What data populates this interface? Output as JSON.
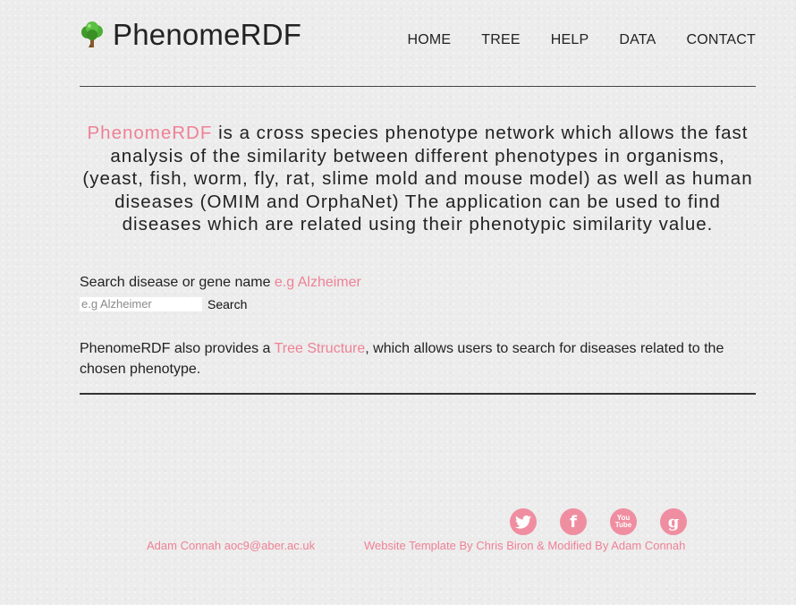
{
  "brand": {
    "name": "PhenomeRDF",
    "icon": "tree-icon"
  },
  "nav": [
    "HOME",
    "TREE",
    "HELP",
    "DATA",
    "CONTACT"
  ],
  "intro": {
    "highlight": "PhenomeRDF",
    "text": " is a cross species phenotype network which allows the fast analysis of the similarity between different phenotypes in organisms, (yeast, fish, worm, fly, rat, slime mold and mouse model) as well as human diseases (OMIM and OrphaNet) The application can be used to find diseases which are related using their phenotypic similarity value."
  },
  "search": {
    "label": "Search disease or gene name ",
    "example": "e.g Alzheimer",
    "placeholder": "e.g Alzheimer",
    "value": "",
    "button": "Search"
  },
  "tree_info": {
    "before": "PhenomeRDF also provides a ",
    "link": "Tree Structure",
    "after": ", which allows users to search for diseases related to the chosen phenotype."
  },
  "social": [
    "twitter-icon",
    "facebook-icon",
    "youtube-icon",
    "google-plus-icon"
  ],
  "social_glyphs": {
    "facebook": "f",
    "youtube_top": "You",
    "youtube_bottom": "Tube",
    "google": "g"
  },
  "footer": {
    "left": "Adam Connah aoc9@aber.ac.uk",
    "right": "Website Template By Chris Biron & Modified By Adam Connah"
  },
  "colors": {
    "accent": "#ef8195",
    "social_bg": "#f08ea1",
    "background": "#ececec",
    "text": "#222222"
  }
}
